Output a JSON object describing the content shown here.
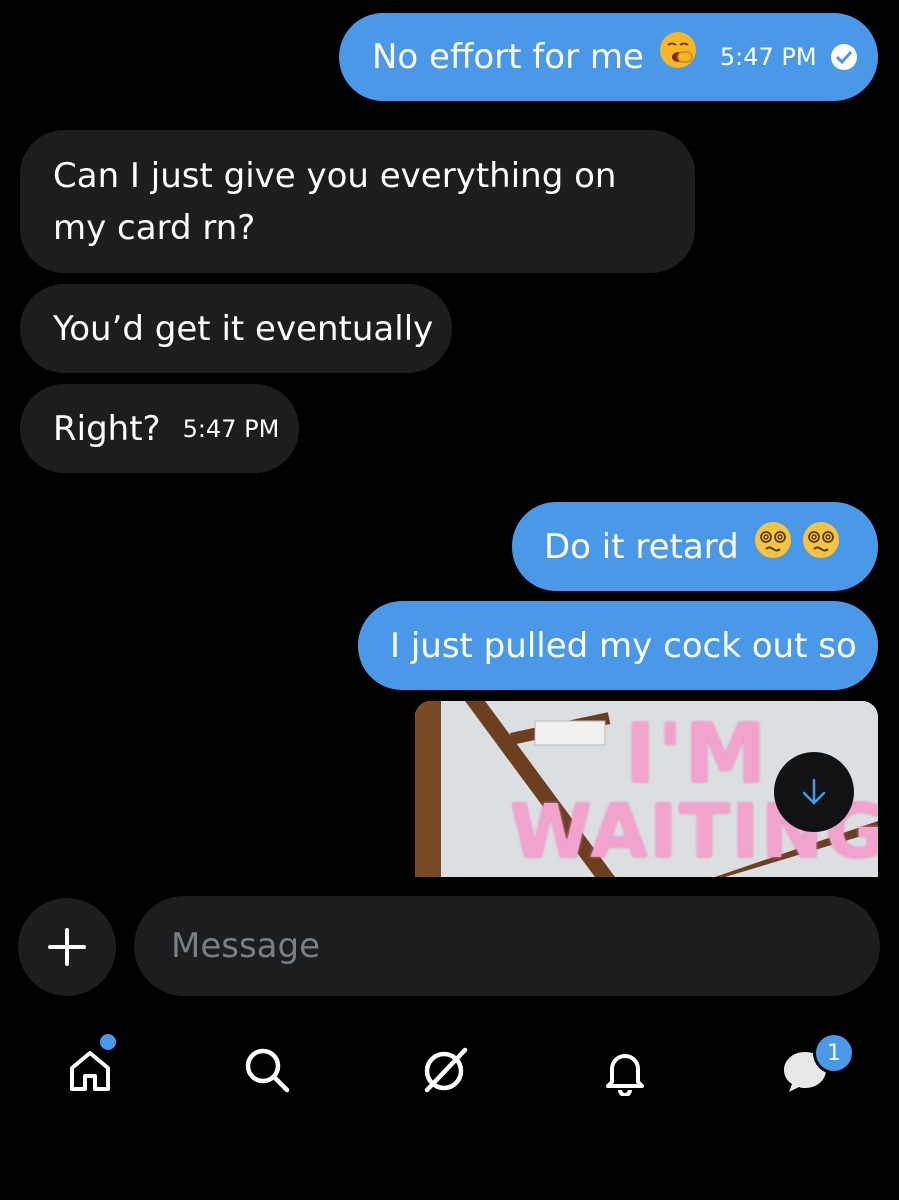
{
  "messages": [
    {
      "id": "b1",
      "direction": "outgoing",
      "text": "No effort for me",
      "emoji": "yawning-face",
      "time": "5:47 PM",
      "status": "read-check-icon"
    },
    {
      "id": "b2",
      "direction": "incoming",
      "text": "Can I just give you everything on my card rn?"
    },
    {
      "id": "b3",
      "direction": "incoming",
      "text": "You’d get it eventually"
    },
    {
      "id": "b4",
      "direction": "incoming",
      "text": "Right?",
      "time": "5:47 PM"
    },
    {
      "id": "b5",
      "direction": "outgoing",
      "text": "Do it retard",
      "emoji": "face-with-spiral-eyes x2"
    },
    {
      "id": "b6",
      "direction": "outgoing",
      "text": "I just pulled my cock out so"
    }
  ],
  "media": {
    "line1": "I'M",
    "line2": "WAITING",
    "icon": "scroll-down-arrow-icon"
  },
  "composer": {
    "placeholder": "Message",
    "add_icon": "plus-icon"
  },
  "bottom_nav": {
    "items": [
      "home-icon",
      "search-icon",
      "grok-icon",
      "bell-icon",
      "messages-icon"
    ],
    "messages_badge": "1"
  },
  "colors": {
    "outgoing_bubble": "#4a99e9",
    "incoming_bubble": "#1c1d1f",
    "background": "#000000"
  }
}
